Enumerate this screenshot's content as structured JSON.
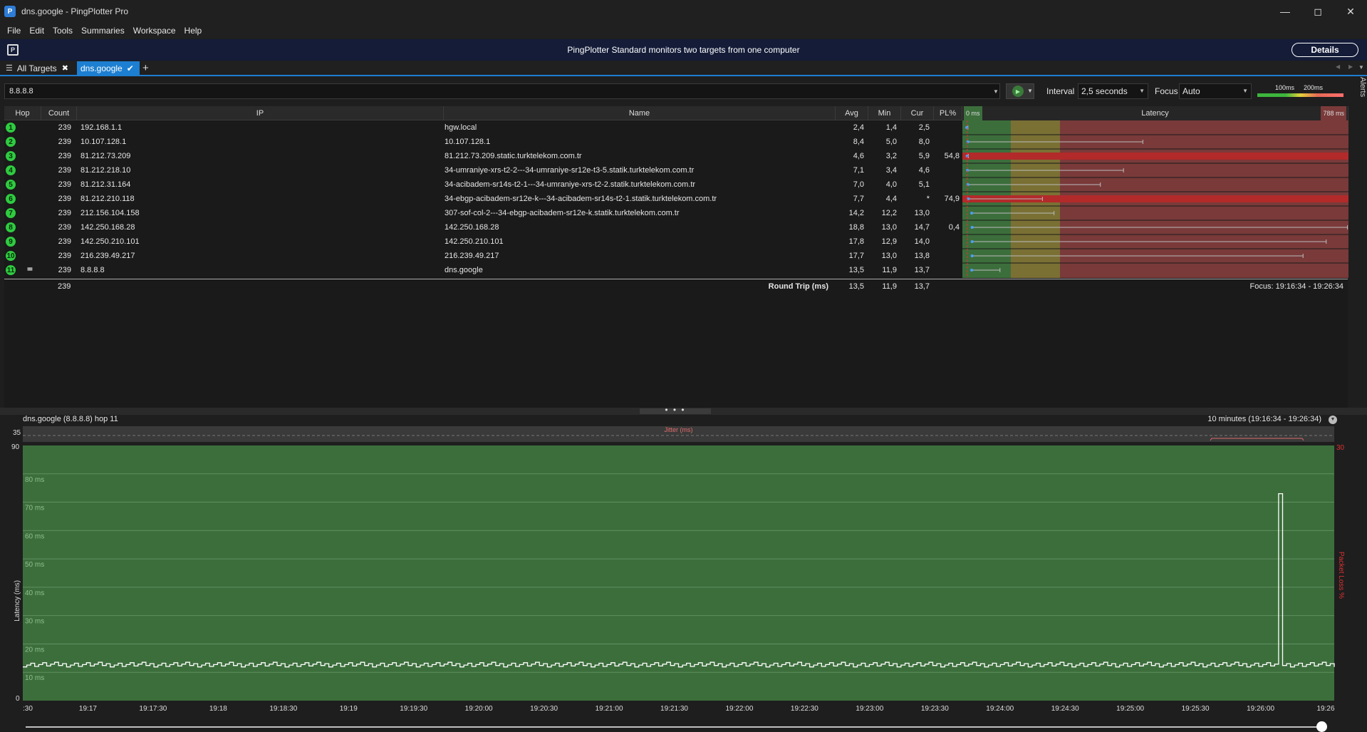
{
  "window": {
    "title": "dns.google - PingPlotter Pro",
    "app_icon": "pingplotter-logo-icon",
    "minimize": "—",
    "maximize": "◻",
    "close": "✕"
  },
  "menu": [
    "File",
    "Edit",
    "Tools",
    "Summaries",
    "Workspace",
    "Help"
  ],
  "banner": {
    "text": "PingPlotter Standard monitors two targets from one computer",
    "details_label": "Details"
  },
  "tabs": {
    "all_targets": "All Targets",
    "active": "dns.google",
    "add": "+"
  },
  "toolbar": {
    "target": "8.8.8.8",
    "interval_label": "Interval",
    "interval_value": "2,5 seconds",
    "focus_label": "Focus",
    "focus_value": "Auto",
    "scale_100": "100ms",
    "scale_200": "200ms",
    "alerts": "Alerts"
  },
  "table": {
    "headers": {
      "hop": "Hop",
      "count": "Count",
      "ip": "IP",
      "name": "Name",
      "avg": "Avg",
      "min": "Min",
      "cur": "Cur",
      "pl": "PL%",
      "latency": "Latency",
      "lat_min": "0 ms",
      "lat_max": "788 ms"
    },
    "rows": [
      {
        "hop": "1",
        "count": "239",
        "ip": "192.168.1.1",
        "name": "hgw.local",
        "avg": "2,4",
        "min": "1,4",
        "cur": "2,5",
        "pl": "",
        "bar": [
          0.002,
          0.007
        ]
      },
      {
        "hop": "2",
        "count": "239",
        "ip": "10.107.128.1",
        "name": "10.107.128.1",
        "avg": "8,4",
        "min": "5,0",
        "cur": "8,0",
        "pl": "",
        "bar": [
          0.005,
          0.46
        ]
      },
      {
        "hop": "3",
        "count": "239",
        "ip": "81.212.73.209",
        "name": "81.212.73.209.static.turktelekom.com.tr",
        "avg": "4,6",
        "min": "3,2",
        "cur": "5,9",
        "pl": "54,8",
        "bar": [
          0.003,
          0.008
        ],
        "loss": true
      },
      {
        "hop": "4",
        "count": "239",
        "ip": "81.212.218.10",
        "name": "34-umraniye-xrs-t2-2---34-umraniye-sr12e-t3-5.statik.turktelekom.com.tr",
        "avg": "7,1",
        "min": "3,4",
        "cur": "4,6",
        "pl": "",
        "bar": [
          0.004,
          0.41
        ]
      },
      {
        "hop": "5",
        "count": "239",
        "ip": "81.212.31.164",
        "name": "34-acibadem-sr14s-t2-1---34-umraniye-xrs-t2-2.statik.turktelekom.com.tr",
        "avg": "7,0",
        "min": "4,0",
        "cur": "5,1",
        "pl": "",
        "bar": [
          0.005,
          0.35
        ]
      },
      {
        "hop": "6",
        "count": "239",
        "ip": "81.212.210.118",
        "name": "34-ebgp-acibadem-sr12e-k---34-acibadem-sr14s-t2-1.statik.turktelekom.com.tr",
        "avg": "7,7",
        "min": "4,4",
        "cur": "*",
        "pl": "74,9",
        "bar": [
          0.006,
          0.2
        ],
        "loss": true
      },
      {
        "hop": "7",
        "count": "239",
        "ip": "212.156.104.158",
        "name": "307-sof-col-2---34-ebgp-acibadem-sr12e-k.statik.turktelekom.com.tr",
        "avg": "14,2",
        "min": "12,2",
        "cur": "13,0",
        "pl": "",
        "bar": [
          0.015,
          0.23
        ]
      },
      {
        "hop": "8",
        "count": "239",
        "ip": "142.250.168.28",
        "name": "142.250.168.28",
        "avg": "18,8",
        "min": "13,0",
        "cur": "14,7",
        "pl": "0,4",
        "bar": [
          0.016,
          0.99
        ]
      },
      {
        "hop": "9",
        "count": "239",
        "ip": "142.250.210.101",
        "name": "142.250.210.101",
        "avg": "17,8",
        "min": "12,9",
        "cur": "14,0",
        "pl": "",
        "bar": [
          0.016,
          0.935
        ]
      },
      {
        "hop": "10",
        "count": "239",
        "ip": "216.239.49.217",
        "name": "216.239.49.217",
        "avg": "17,7",
        "min": "13,0",
        "cur": "13,8",
        "pl": "",
        "bar": [
          0.016,
          0.875
        ]
      },
      {
        "hop": "11",
        "count": "239",
        "ip": "8.8.8.8",
        "name": "dns.google",
        "avg": "13,5",
        "min": "11,9",
        "cur": "13,7",
        "pl": "",
        "bar": [
          0.015,
          0.09
        ]
      }
    ],
    "round_trip": {
      "count": "239",
      "label": "Round Trip (ms)",
      "avg": "13,5",
      "min": "11,9",
      "cur": "13,7",
      "focus": "Focus: 19:16:34 - 19:26:34"
    }
  },
  "graph": {
    "title": "dns.google (8.8.8.8) hop 11",
    "range": "10 minutes (19:16:34 - 19:26:34)",
    "jitter_label": "Jitter (ms)",
    "jitter_max": "35",
    "ylabel": "Latency (ms)",
    "y2label": "Packet Loss %",
    "y2_max": "30",
    "ymax": "90",
    "ymin": "0",
    "yticks": [
      "80 ms",
      "70 ms",
      "60 ms",
      "50 ms",
      "40 ms",
      "30 ms",
      "20 ms",
      "10 ms"
    ],
    "xticks": [
      ":30",
      "19:17",
      "19:17:30",
      "19:18",
      "19:18:30",
      "19:19",
      "19:19:30",
      "19:20:00",
      "19:20:30",
      "19:21:00",
      "19:21:30",
      "19:22:00",
      "19:22:30",
      "19:23:00",
      "19:23:30",
      "19:24:00",
      "19:24:30",
      "19:25:00",
      "19:25:30",
      "19:26:00",
      "19:26"
    ]
  },
  "chart_data": {
    "type": "line",
    "ylabel": "Latency (ms)",
    "ylim": [
      0,
      90
    ],
    "spike": {
      "x": "19:25:38",
      "y": 73
    },
    "baseline_ms": 12.5
  },
  "colors": {
    "good": "#3c6e3c",
    "warn": "#7a7034",
    "bad": "#7a3a3a",
    "accent": "#1d7fd1",
    "hop_badge": "#2ecc40"
  }
}
